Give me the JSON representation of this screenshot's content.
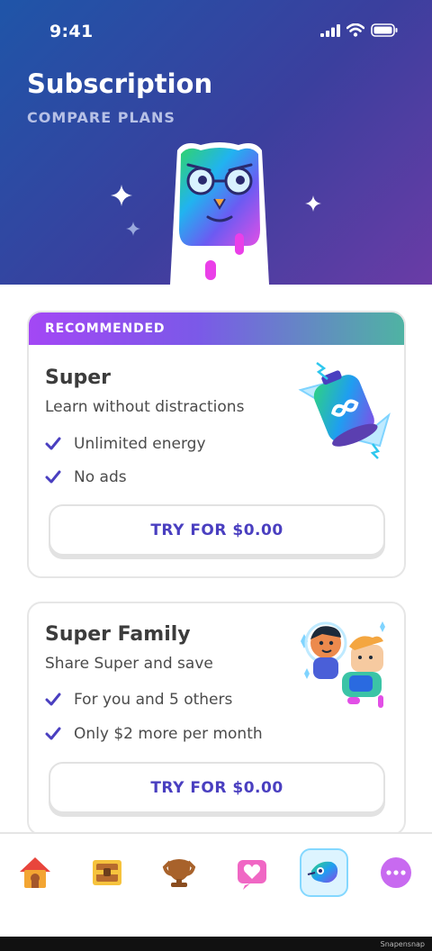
{
  "status": {
    "time": "9:41"
  },
  "header": {
    "title": "Subscription",
    "subtitle": "COMPARE PLANS"
  },
  "plans": [
    {
      "badge": "RECOMMENDED",
      "name": "Super",
      "description": "Learn without distractions",
      "features": [
        "Unlimited energy",
        "No ads"
      ],
      "cta": "TRY FOR $0.00"
    },
    {
      "name": "Super Family",
      "description": "Share Super and save",
      "features": [
        "For you and 5 others",
        "Only $2 more per month"
      ],
      "cta": "TRY FOR $0.00"
    }
  ],
  "nav": {
    "items": [
      "home-icon",
      "chest-icon",
      "trophy-icon",
      "heart-icon",
      "super-icon",
      "more-icon"
    ],
    "active": "super-icon"
  },
  "watermark": "Snapensnap",
  "colors": {
    "accent": "#4a3fc0",
    "header_start": "#1f55a8",
    "header_end": "#6a3ca6"
  }
}
